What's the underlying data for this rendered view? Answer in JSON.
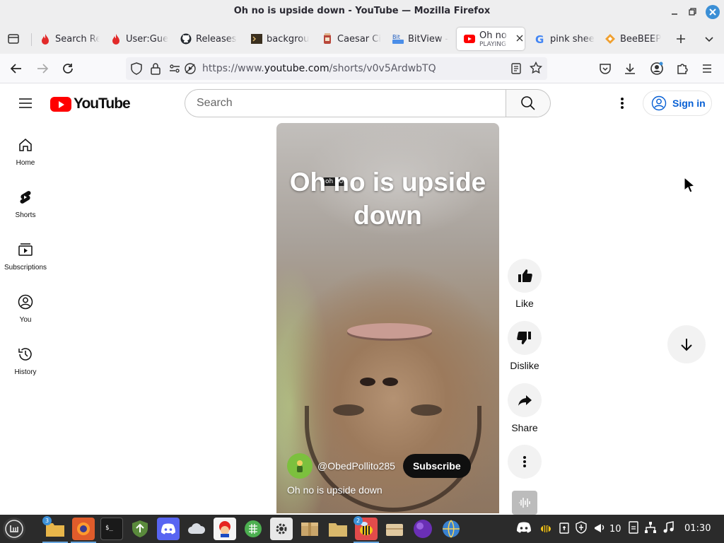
{
  "window": {
    "title": "Oh no is upside down - YouTube — Mozilla Firefox"
  },
  "tabs": [
    {
      "label": "Search Re",
      "favicon": "flame-icon"
    },
    {
      "label": "User:Gue",
      "favicon": "flame-icon"
    },
    {
      "label": "Releases",
      "favicon": "github-icon"
    },
    {
      "label": "backgrou",
      "favicon": "terminal-icon"
    },
    {
      "label": "Caesar Ci",
      "favicon": "jar-icon"
    },
    {
      "label": "BitView -",
      "favicon": "bitview-icon"
    },
    {
      "label": "Oh no",
      "sublabel": "PLAYING",
      "favicon": "youtube-icon",
      "active": true
    },
    {
      "label": "pink shee",
      "favicon": "google-icon"
    },
    {
      "label": "BeeBEEP",
      "favicon": "beebeep-icon"
    }
  ],
  "navbar": {
    "url_prefix": "https://www.",
    "url_domain": "youtube.com",
    "url_path": "/shorts/v0v5ArdwbTQ"
  },
  "youtube": {
    "logo_text": "YouTube",
    "search_placeholder": "Search",
    "signin_label": "Sign in",
    "guide": [
      {
        "label": "Home",
        "icon": "home-icon"
      },
      {
        "label": "Shorts",
        "icon": "shorts-icon"
      },
      {
        "label": "Subscriptions",
        "icon": "subscriptions-icon"
      },
      {
        "label": "You",
        "icon": "you-icon"
      },
      {
        "label": "History",
        "icon": "history-icon"
      }
    ],
    "short": {
      "overlay_title": "Oh no is upside down",
      "overlay_tag": "oh no",
      "channel": "@ObedPollito285",
      "subscribe_label": "Subscribe",
      "description": "Oh no is upside down"
    },
    "actions": {
      "like": "Like",
      "dislike": "Dislike",
      "share": "Share"
    }
  },
  "taskbar": {
    "file_badge": "3",
    "bee_badge": "2",
    "tray_number": "10",
    "clock": "01:30"
  },
  "colors": {
    "youtube_red": "#ff0000",
    "link_blue": "#065fd4",
    "taskbar_bg": "#2b2b2b"
  }
}
